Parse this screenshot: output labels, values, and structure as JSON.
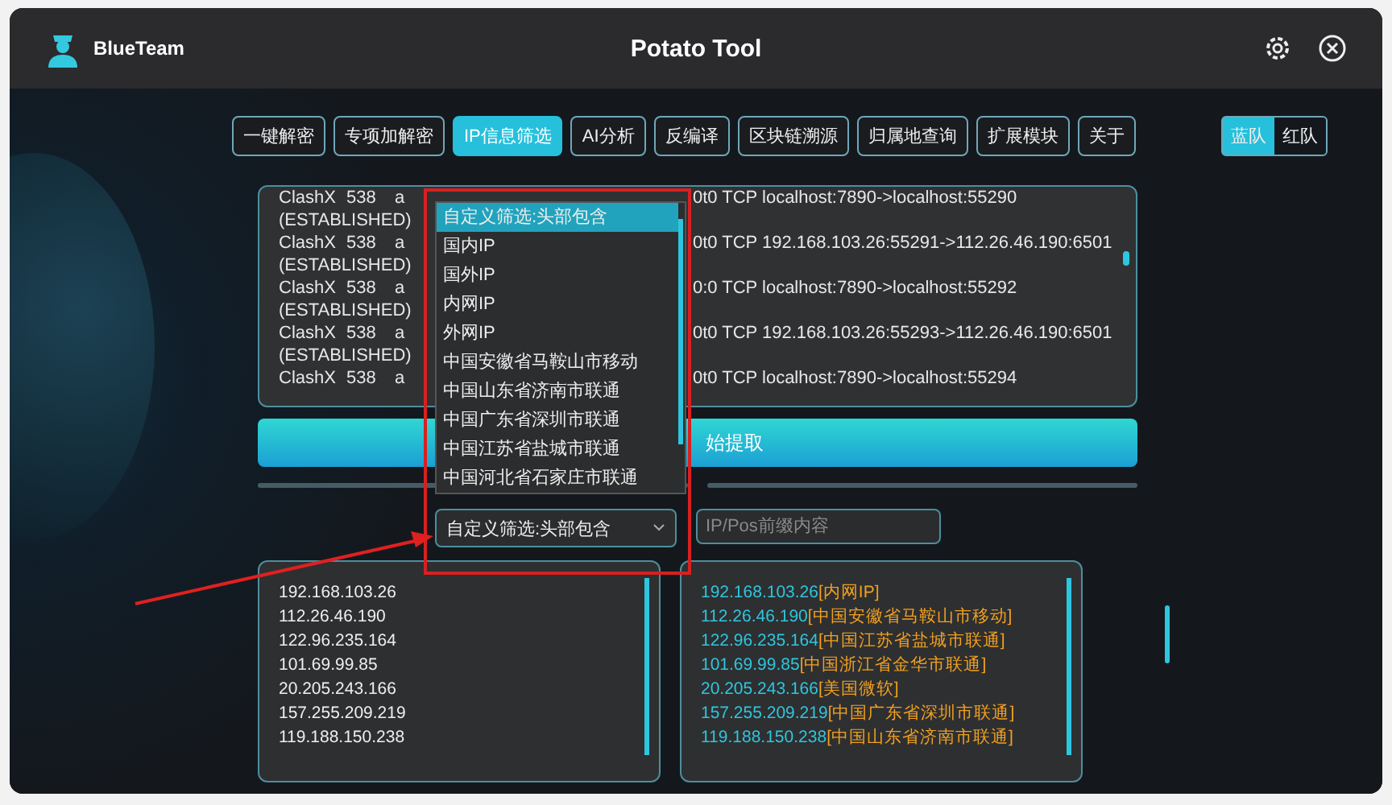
{
  "window": {
    "brand": "BlueTeam",
    "title": "Potato Tool"
  },
  "tabs": [
    {
      "label": "一键解密",
      "selected": false
    },
    {
      "label": "专项加解密",
      "selected": false
    },
    {
      "label": "IP信息筛选",
      "selected": true
    },
    {
      "label": "AI分析",
      "selected": false
    },
    {
      "label": "反编译",
      "selected": false
    },
    {
      "label": "区块链溯源",
      "selected": false
    },
    {
      "label": "归属地查询",
      "selected": false
    },
    {
      "label": "扩展模块",
      "selected": false
    },
    {
      "label": "关于",
      "selected": false
    }
  ],
  "team_toggle": [
    {
      "label": "蓝队",
      "selected": true
    },
    {
      "label": "红队",
      "selected": false
    }
  ],
  "log_rows": [
    {
      "process": "ClashX",
      "pid": "538",
      "user": "a",
      "connection": "0t0  TCP localhost:7890->localhost:55290",
      "state": "(ESTABLISHED)"
    },
    {
      "process": "ClashX",
      "pid": "538",
      "user": "a",
      "connection": "0t0  TCP 192.168.103.26:55291->112.26.46.190:6501",
      "state": "(ESTABLISHED)"
    },
    {
      "process": "ClashX",
      "pid": "538",
      "user": "a",
      "connection": "0:0  TCP localhost:7890->localhost:55292",
      "state": "(ESTABLISHED)"
    },
    {
      "process": "ClashX",
      "pid": "538",
      "user": "a",
      "connection": "0t0  TCP 192.168.103.26:55293->112.26.46.190:6501",
      "state": "(ESTABLISHED)"
    },
    {
      "process": "ClashX",
      "pid": "538",
      "user": "a",
      "connection": "0t0  TCP localhost:7890->localhost:55294"
    }
  ],
  "extract_button": "始提取",
  "filter_dropdown": {
    "value": "自定义筛选:头部包含",
    "options": [
      {
        "label": "自定义筛选:头部包含",
        "selected": true
      },
      {
        "label": "国内IP",
        "selected": false
      },
      {
        "label": "国外IP",
        "selected": false
      },
      {
        "label": "内网IP",
        "selected": false
      },
      {
        "label": "外网IP",
        "selected": false
      },
      {
        "label": "中国安徽省马鞍山市移动",
        "selected": false
      },
      {
        "label": "中国山东省济南市联通",
        "selected": false
      },
      {
        "label": "中国广东省深圳市联通",
        "selected": false
      },
      {
        "label": "中国江苏省盐城市联通",
        "selected": false
      },
      {
        "label": "中国河北省石家庄市联通",
        "selected": false
      }
    ]
  },
  "prefix_field": {
    "placeholder": "IP/Pos前缀内容"
  },
  "ip_list": [
    "192.168.103.26",
    "112.26.46.190",
    "122.96.235.164",
    "101.69.99.85",
    "20.205.243.166",
    "157.255.209.219",
    "119.188.150.238"
  ],
  "results": [
    {
      "ip": "192.168.103.26",
      "location": "[内网IP]"
    },
    {
      "ip": "112.26.46.190",
      "location": "[中国安徽省马鞍山市移动]"
    },
    {
      "ip": "122.96.235.164",
      "location": "[中国江苏省盐城市联通]"
    },
    {
      "ip": "101.69.99.85",
      "location": "[中国浙江省金华市联通]"
    },
    {
      "ip": "20.205.243.166",
      "location": "[美国微软]"
    },
    {
      "ip": "157.255.209.219",
      "location": "[中国广东省深圳市联通]"
    },
    {
      "ip": "119.188.150.238",
      "location": "[中国山东省济南市联通]"
    }
  ]
}
